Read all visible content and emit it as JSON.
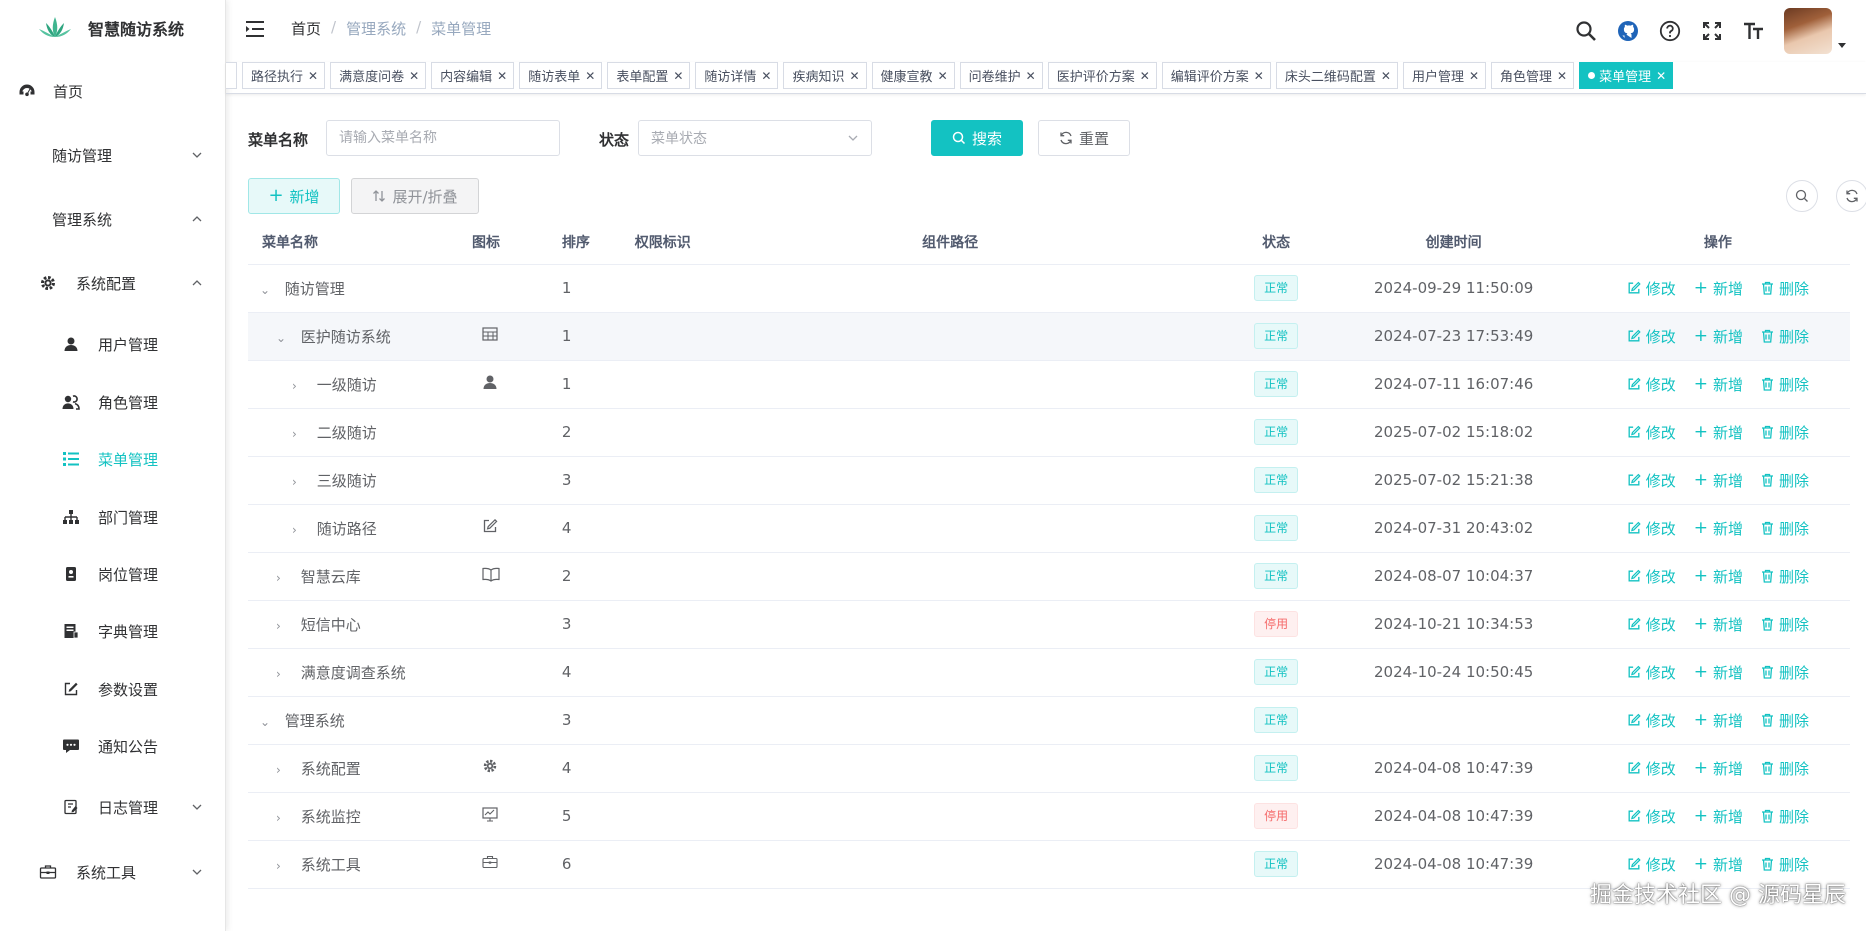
{
  "app": {
    "title": "智慧随访系统"
  },
  "sidebar": {
    "items": [
      {
        "label": "首页"
      },
      {
        "label": "随访管理"
      },
      {
        "label": "管理系统"
      },
      {
        "label": "系统配置"
      },
      {
        "label": "用户管理"
      },
      {
        "label": "角色管理"
      },
      {
        "label": "菜单管理"
      },
      {
        "label": "部门管理"
      },
      {
        "label": "岗位管理"
      },
      {
        "label": "字典管理"
      },
      {
        "label": "参数设置"
      },
      {
        "label": "通知公告"
      },
      {
        "label": "日志管理"
      },
      {
        "label": "系统工具"
      }
    ],
    "accent": "#13c2c2"
  },
  "breadcrumb": [
    "首页",
    "管理系统",
    "菜单管理"
  ],
  "tabs": [
    {
      "label": "路径执行"
    },
    {
      "label": "满意度问卷"
    },
    {
      "label": "内容编辑"
    },
    {
      "label": "随访表单"
    },
    {
      "label": "表单配置"
    },
    {
      "label": "随访详情"
    },
    {
      "label": "疾病知识"
    },
    {
      "label": "健康宣教"
    },
    {
      "label": "问卷维护"
    },
    {
      "label": "医护评价方案"
    },
    {
      "label": "编辑评价方案"
    },
    {
      "label": "床头二维码配置"
    },
    {
      "label": "用户管理"
    },
    {
      "label": "角色管理"
    },
    {
      "label": "菜单管理"
    }
  ],
  "search": {
    "name_label": "菜单名称",
    "name_placeholder": "请输入菜单名称",
    "status_label": "状态",
    "status_placeholder": "菜单状态",
    "search_button": "搜索",
    "reset_button": "重置"
  },
  "toolbar": {
    "add_button": "新增",
    "expand_button": "展开/折叠"
  },
  "table": {
    "columns": [
      "菜单名称",
      "图标",
      "排序",
      "权限标识",
      "组件路径",
      "状态",
      "创建时间",
      "操作"
    ],
    "rows": [
      {
        "name": "随访管理",
        "icon": "",
        "order": "1",
        "status": "正常",
        "created": "2024-09-29 11:50:09"
      },
      {
        "name": "医护随访系统",
        "icon": "table-icon",
        "order": "1",
        "status": "正常",
        "created": "2024-07-23 17:53:49"
      },
      {
        "name": "一级随访",
        "icon": "user-icon",
        "order": "1",
        "status": "正常",
        "created": "2024-07-11 16:07:46"
      },
      {
        "name": "二级随访",
        "icon": "",
        "order": "2",
        "status": "正常",
        "created": "2025-07-02 15:18:02"
      },
      {
        "name": "三级随访",
        "icon": "",
        "order": "3",
        "status": "正常",
        "created": "2025-07-02 15:21:38"
      },
      {
        "name": "随访路径",
        "icon": "edit-icon",
        "order": "4",
        "status": "正常",
        "created": "2024-07-31 20:43:02"
      },
      {
        "name": "智慧云库",
        "icon": "book-icon",
        "order": "2",
        "status": "正常",
        "created": "2024-08-07 10:04:37"
      },
      {
        "name": "短信中心",
        "icon": "",
        "order": "3",
        "status": "停用",
        "created": "2024-10-21 10:34:53"
      },
      {
        "name": "满意度调查系统",
        "icon": "",
        "order": "4",
        "status": "正常",
        "created": "2024-10-24 10:50:45"
      },
      {
        "name": "管理系统",
        "icon": "",
        "order": "3",
        "status": "正常",
        "created": ""
      },
      {
        "name": "系统配置",
        "icon": "gear-icon",
        "order": "4",
        "status": "正常",
        "created": "2024-04-08 10:47:39"
      },
      {
        "name": "系统监控",
        "icon": "monitor-icon",
        "order": "5",
        "status": "停用",
        "created": "2024-04-08 10:47:39"
      },
      {
        "name": "系统工具",
        "icon": "toolbox-icon",
        "order": "6",
        "status": "正常",
        "created": "2024-04-08 10:47:39"
      }
    ],
    "ops": {
      "edit": "修改",
      "add": "新增",
      "delete": "删除"
    }
  },
  "watermark": "掘金技术社区 @ 源码星辰"
}
